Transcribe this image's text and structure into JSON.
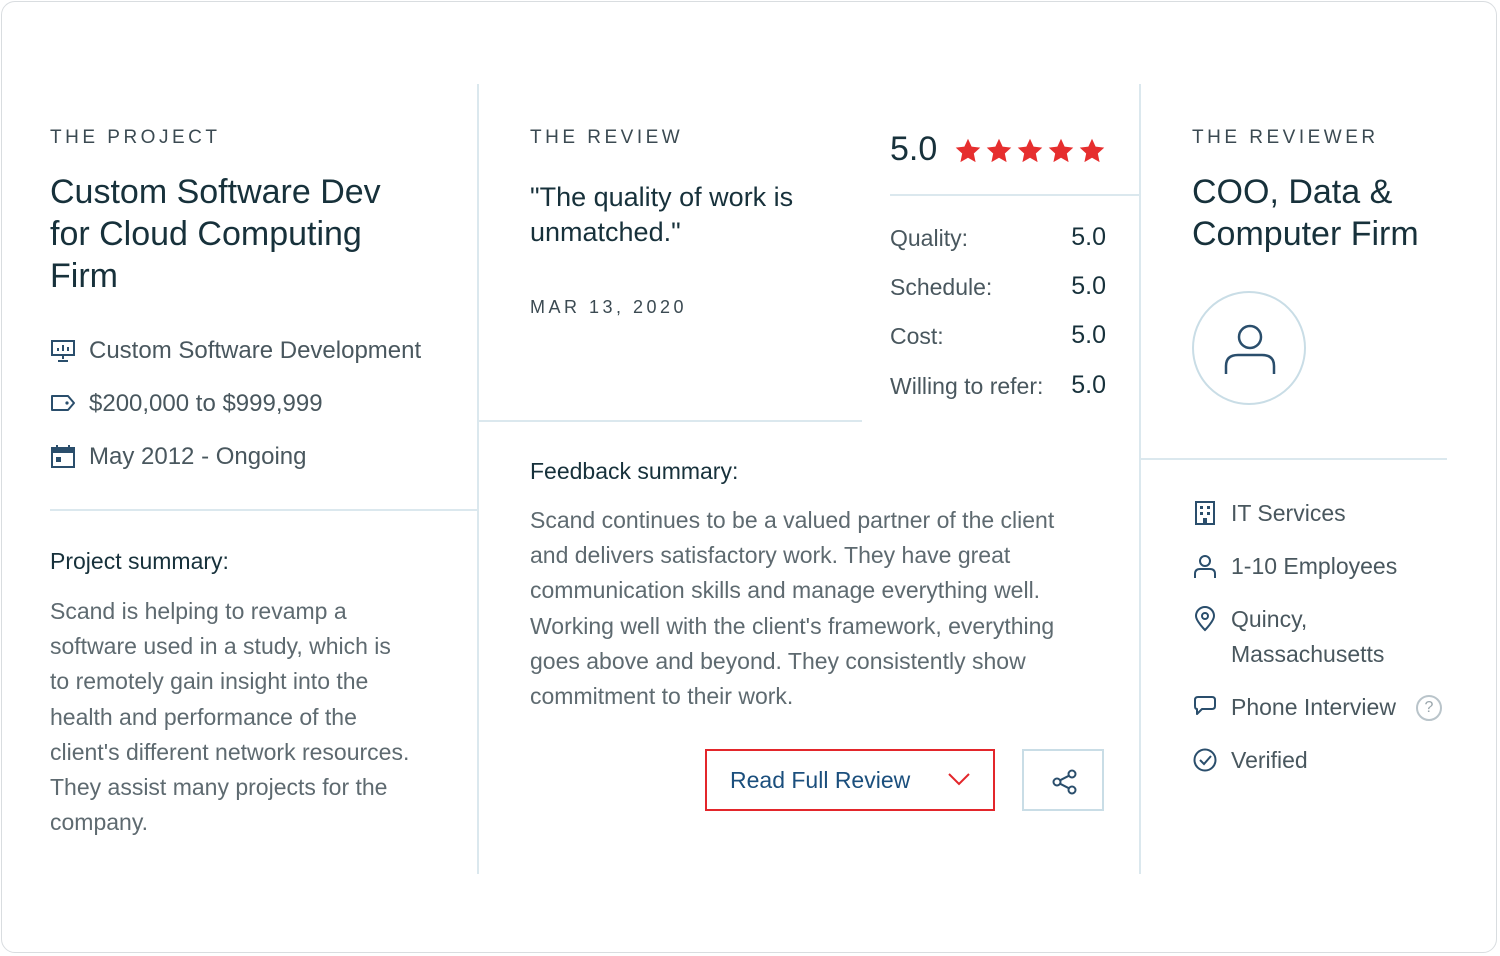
{
  "project": {
    "eyebrow": "THE PROJECT",
    "title_lines": [
      "Custom Software Dev",
      "for Cloud Computing",
      "Firm"
    ],
    "service": "Custom Software Development",
    "budget": "$200,000 to $999,999",
    "dates": "May 2012 - Ongoing",
    "summary_label": "Project summary:",
    "summary_lines": [
      "Scand is helping to revamp a",
      "software used in a study, which is",
      "to remotely gain insight into the",
      "health and performance of the",
      "client's different network resources.",
      "They assist many projects for the",
      "company."
    ]
  },
  "review": {
    "eyebrow": "THE REVIEW",
    "quote_lines": [
      "\"The quality of work is",
      "unmatched.\""
    ],
    "date": "MAR 13, 2020",
    "overall": "5.0",
    "stars": 5,
    "star_color": "#e62e2e",
    "scores": [
      {
        "label": "Quality:",
        "value": "5.0"
      },
      {
        "label": "Schedule:",
        "value": "5.0"
      },
      {
        "label": "Cost:",
        "value": "5.0"
      },
      {
        "label": "Willing to refer:",
        "value": "5.0"
      }
    ],
    "feedback_label": "Feedback summary:",
    "feedback_lines": [
      "Scand continues to be a valued partner of the client",
      "and delivers satisfactory work. They have great",
      "communication skills and manage everything well.",
      "Working well with the client's framework, everything",
      "goes above and beyond. They consistently show",
      "commitment to their work."
    ],
    "read_full_label": "Read Full Review",
    "share_icon": "share-icon"
  },
  "reviewer": {
    "eyebrow": "THE REVIEWER",
    "title_lines": [
      "COO, Data &",
      "Computer Firm"
    ],
    "industry": "IT Services",
    "size": "1-10 Employees",
    "location_lines": [
      "Quincy,",
      "Massachusetts"
    ],
    "interview": "Phone Interview",
    "help_glyph": "?",
    "verified": "Verified"
  },
  "colors": {
    "accent_blue": "#1b4f7d",
    "highlight_red": "#e3262b",
    "divider": "#dbe8ee",
    "icon_blue": "#2a4e6c"
  }
}
